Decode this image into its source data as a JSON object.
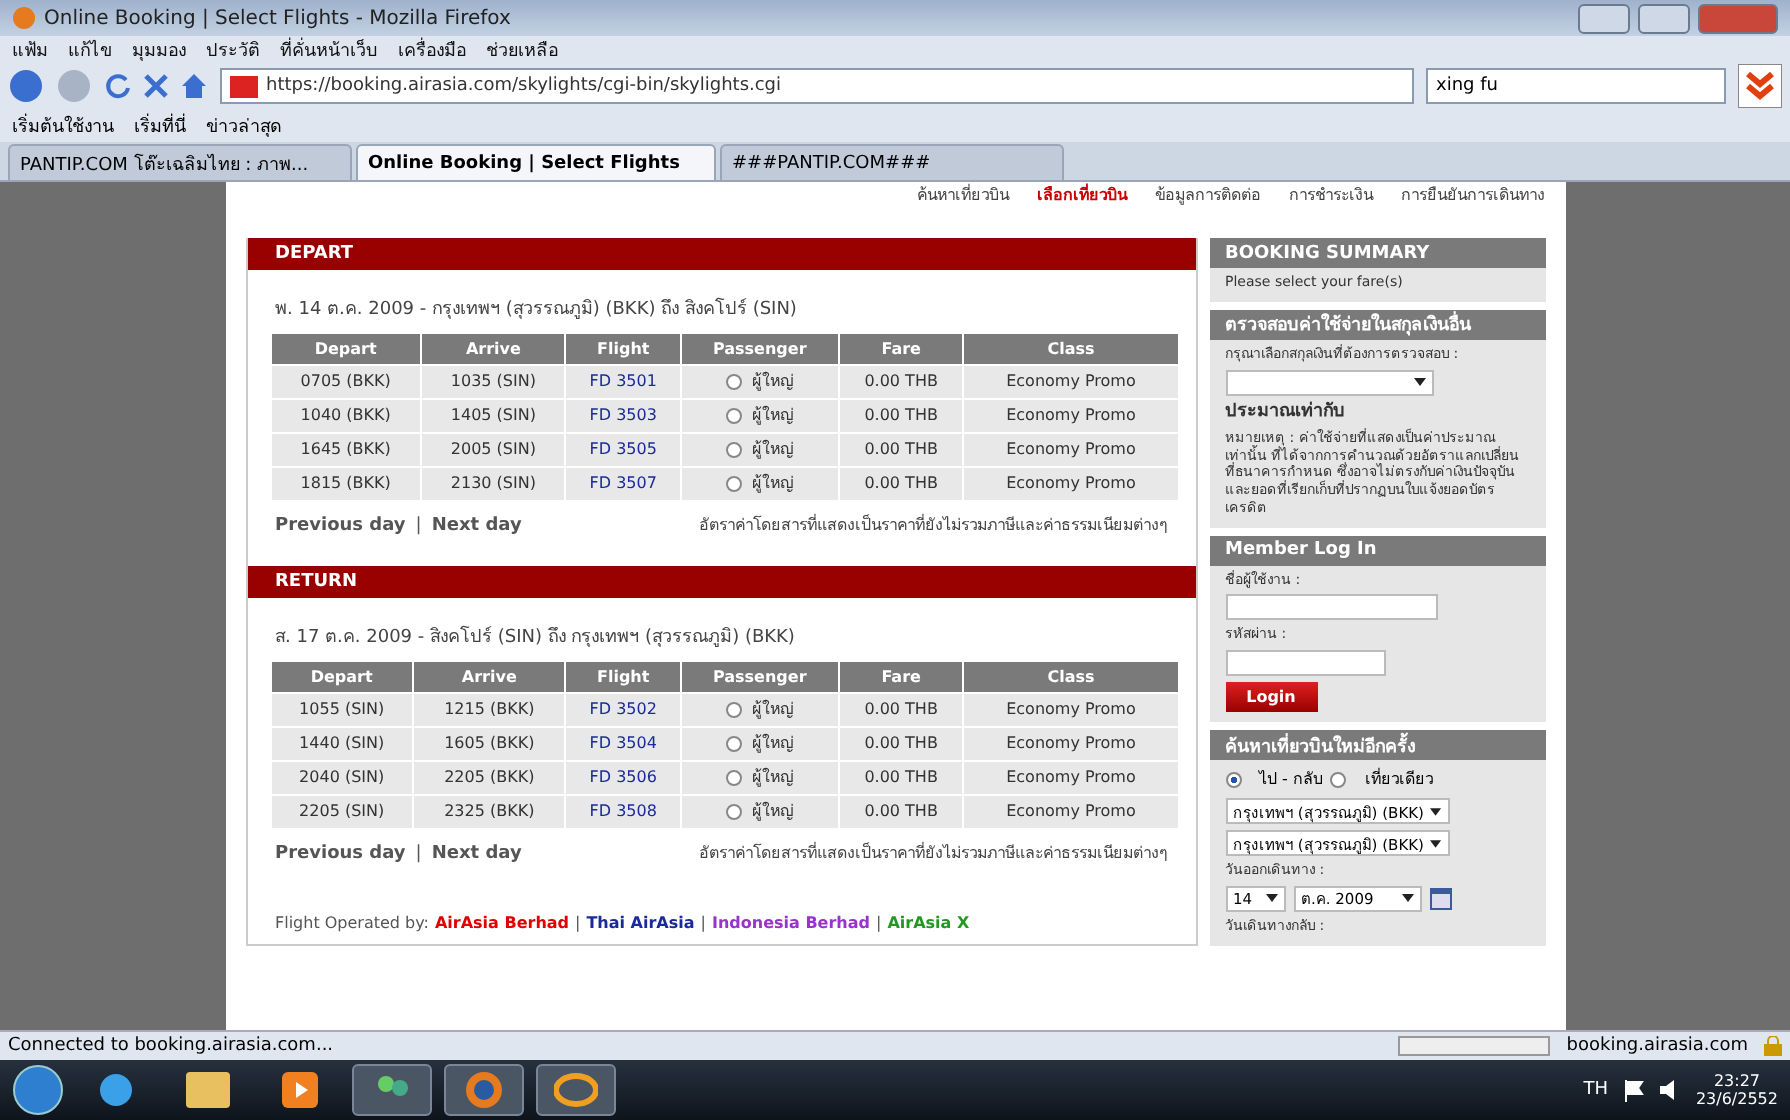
{
  "window": {
    "title": "Online Booking | Select Flights - Mozilla Firefox"
  },
  "menu": [
    "แฟ้ม",
    "แก้ไข",
    "มุมมอง",
    "ประวัติ",
    "ที่คั่นหน้าเว็บ",
    "เครื่องมือ",
    "ช่วยเหลือ"
  ],
  "address": {
    "value": "https://booking.airasia.com/skylights/cgi-bin/skylights.cgi"
  },
  "search": {
    "value": "xing fu"
  },
  "bookmarks": [
    "เริ่มต้นใช้งาน",
    "เริ่มที่นี่",
    "ข่าวล่าสุด"
  ],
  "tabs": [
    {
      "label": "PANTIP.COM โต๊ะเฉลิมไทย : ภาพ...",
      "selected": false
    },
    {
      "label": "Online Booking | Select Flights",
      "selected": true
    },
    {
      "label": "###PANTIP.COM###",
      "selected": false
    }
  ],
  "steps": [
    {
      "label": "ค้นหาเที่ยวบิน",
      "selected": false
    },
    {
      "label": "เลือกเที่ยวบิน",
      "selected": true
    },
    {
      "label": "ข้อมูลการติดต่อ",
      "selected": false
    },
    {
      "label": "การชำระเงิน",
      "selected": false
    },
    {
      "label": "การยืนยันการเดินทาง",
      "selected": false
    }
  ],
  "sections": [
    {
      "title": "DEPART",
      "route": "พ. 14 ต.ค. 2009 - กรุงเทพฯ (สุวรรณภูมิ) (BKK) ถึง สิงคโปร์ (SIN)",
      "columns": [
        "Depart",
        "Arrive",
        "Flight",
        "Passenger",
        "Fare",
        "Class"
      ],
      "rows": [
        {
          "depart": "0705 (BKK)",
          "arrive": "1035 (SIN)",
          "flight": "FD 3501",
          "passenger": "ผู้ใหญ่",
          "fare": "0.00 THB",
          "class": "Economy Promo",
          "selected": false
        },
        {
          "depart": "1040 (BKK)",
          "arrive": "1405 (SIN)",
          "flight": "FD 3503",
          "passenger": "ผู้ใหญ่",
          "fare": "0.00 THB",
          "class": "Economy Promo",
          "selected": false
        },
        {
          "depart": "1645 (BKK)",
          "arrive": "2005 (SIN)",
          "flight": "FD 3505",
          "passenger": "ผู้ใหญ่",
          "fare": "0.00 THB",
          "class": "Economy Promo",
          "selected": false
        },
        {
          "depart": "1815 (BKK)",
          "arrive": "2130 (SIN)",
          "flight": "FD 3507",
          "passenger": "ผู้ใหญ่",
          "fare": "0.00 THB",
          "class": "Economy Promo",
          "selected": false
        }
      ],
      "prev": "Previous day",
      "separator": "|",
      "next": "Next day",
      "note": "อัตราค่าโดยสารที่แสดงเป็นราคาที่ยังไม่รวมภาษีและค่าธรรมเนียมต่างๆ"
    },
    {
      "title": "RETURN",
      "route": "ส. 17 ต.ค. 2009 - สิงคโปร์ (SIN) ถึง กรุงเทพฯ (สุวรรณภูมิ) (BKK)",
      "columns": [
        "Depart",
        "Arrive",
        "Flight",
        "Passenger",
        "Fare",
        "Class"
      ],
      "rows": [
        {
          "depart": "1055 (SIN)",
          "arrive": "1215 (BKK)",
          "flight": "FD 3502",
          "passenger": "ผู้ใหญ่",
          "fare": "0.00 THB",
          "class": "Economy Promo",
          "selected": false
        },
        {
          "depart": "1440 (SIN)",
          "arrive": "1605 (BKK)",
          "flight": "FD 3504",
          "passenger": "ผู้ใหญ่",
          "fare": "0.00 THB",
          "class": "Economy Promo",
          "selected": false
        },
        {
          "depart": "2040 (SIN)",
          "arrive": "2205 (BKK)",
          "flight": "FD 3506",
          "passenger": "ผู้ใหญ่",
          "fare": "0.00 THB",
          "class": "Economy Promo",
          "selected": false
        },
        {
          "depart": "2205 (SIN)",
          "arrive": "2325 (BKK)",
          "flight": "FD 3508",
          "passenger": "ผู้ใหญ่",
          "fare": "0.00 THB",
          "class": "Economy Promo",
          "selected": false
        }
      ],
      "prev": "Previous day",
      "separator": "|",
      "next": "Next day",
      "note": "อัตราค่าโดยสารที่แสดงเป็นราคาที่ยังไม่รวมภาษีและค่าธรรมเนียมต่างๆ"
    }
  ],
  "operated": {
    "label": "Flight Operated by:",
    "separator": "|",
    "carriers": [
      {
        "name": "AirAsia Berhad",
        "color": "#e00000"
      },
      {
        "name": "Thai AirAsia",
        "color": "#1a2a99"
      },
      {
        "name": "Indonesia Berhad",
        "color": "#9933cc"
      },
      {
        "name": "AirAsia X",
        "color": "#229922"
      }
    ]
  },
  "summary": {
    "title": "BOOKING SUMMARY",
    "text": "Please select your fare(s)"
  },
  "currency": {
    "title": "ตรวจสอบค่าใช้จ่ายในสกุลเงินอื่น",
    "label": "กรุณาเลือกสกุลเงินที่ต้องการตรวจสอบ :",
    "result": "ประมาณเท่ากับ",
    "note": "หมายเหตุ : ค่าใช้จ่ายที่แสดงเป็นค่าประมาณเท่านั้น ที่ได้จากการคำนวณด้วยอัตราแลกเปลี่ยนที่ธนาคารกำหนด ซึ่งอาจไม่ตรงกับค่าเงินปัจจุบันและยอดที่เรียกเก็บที่ปรากฏบนใบแจ้งยอดบัตรเครดิต"
  },
  "login": {
    "title": "Member Log In",
    "username": "ชื่อผู้ใช้งาน :",
    "password": "รหัสผ่าน :",
    "button": "Login"
  },
  "research": {
    "title": "ค้นหาเที่ยวบินใหม่อีกครั้ง",
    "trip": [
      {
        "label": "ไป - กลับ",
        "selected": true
      },
      {
        "label": "เที่ยวเดียว",
        "selected": false
      }
    ],
    "from": "กรุงเทพฯ (สุวรรณภูมิ) (BKK)",
    "to": "กรุงเทพฯ (สุวรรณภูมิ) (BKK)",
    "date_label": "วันออกเดินทาง :",
    "day": "14",
    "month": "ต.ค. 2009",
    "return_label": "วันเดินทางกลับ :"
  },
  "status_bar": {
    "text": "Connected to booking.airasia.com...",
    "host": "booking.airasia.com",
    "level": 0.0
  },
  "taskbar": {
    "lang": "TH",
    "time": "23:27",
    "date": "23/6/2552"
  }
}
